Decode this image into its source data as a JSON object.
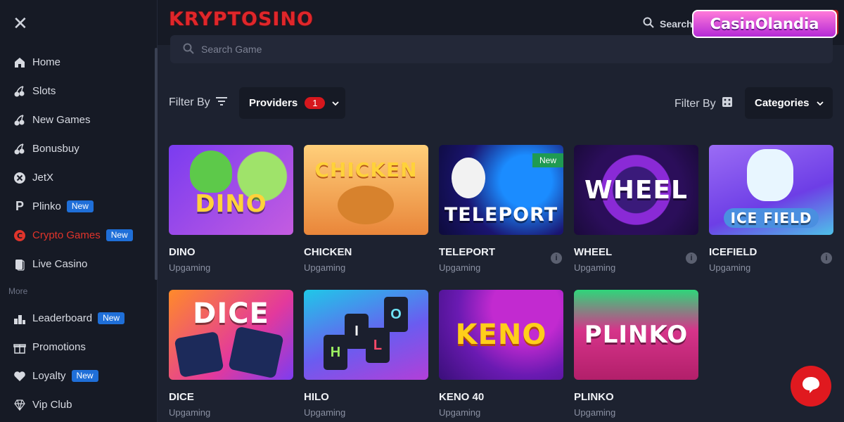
{
  "brand": {
    "logo_text": "KRYPTOSINO"
  },
  "watermark": {
    "text": "CasinOlandia"
  },
  "header": {
    "search_label": "Search"
  },
  "sidebar": {
    "items": [
      {
        "label": "Home",
        "icon": "home-icon"
      },
      {
        "label": "Slots",
        "icon": "cherry-icon"
      },
      {
        "label": "New Games",
        "icon": "cherry-icon"
      },
      {
        "label": "Bonusbuy",
        "icon": "cherry-icon"
      },
      {
        "label": "JetX",
        "icon": "x-circle-icon"
      },
      {
        "label": "Plinko",
        "icon": "p-icon",
        "badge": "New"
      },
      {
        "label": "Crypto Games",
        "icon": "crypto-icon",
        "badge": "New",
        "active": true
      },
      {
        "label": "Live Casino",
        "icon": "cards-icon"
      }
    ],
    "section_label": "More",
    "more_items": [
      {
        "label": "Leaderboard",
        "icon": "leaderboard-icon",
        "badge": "New"
      },
      {
        "label": "Promotions",
        "icon": "gift-icon"
      },
      {
        "label": "Loyalty",
        "icon": "heart-icon",
        "badge": "New"
      },
      {
        "label": "Vip Club",
        "icon": "diamond-icon"
      }
    ]
  },
  "search": {
    "placeholder": "Search Game"
  },
  "filters": {
    "left_label": "Filter By",
    "providers_label": "Providers",
    "providers_count": "1",
    "right_label": "Filter By",
    "categories_label": "Categories"
  },
  "games": [
    {
      "title": "DINO",
      "provider": "Upgaming",
      "thumb_text": "DINO"
    },
    {
      "title": "CHICKEN",
      "provider": "Upgaming",
      "thumb_text": "CHICKEN"
    },
    {
      "title": "TELEPORT",
      "provider": "Upgaming",
      "thumb_text": "TELEPORT",
      "tag": "New",
      "info": true
    },
    {
      "title": "WHEEL",
      "provider": "Upgaming",
      "thumb_text": "WHEEL",
      "info": true
    },
    {
      "title": "ICEFIELD",
      "provider": "Upgaming",
      "thumb_text": "ICE FIELD",
      "info": true
    },
    {
      "title": "DICE",
      "provider": "Upgaming",
      "thumb_text": "DICE"
    },
    {
      "title": "HILO",
      "provider": "Upgaming",
      "thumb_text": ""
    },
    {
      "title": "KENO 40",
      "provider": "Upgaming",
      "thumb_text": "KENO"
    },
    {
      "title": "PLINKO",
      "provider": "Upgaming",
      "thumb_text": "PLINKO"
    }
  ],
  "hilo_letters": [
    "H",
    "I",
    "L",
    "O"
  ],
  "colors": {
    "accent_red": "#e0342b",
    "badge_blue": "#1f6fd8",
    "bg": "#1d2230",
    "sidebar_bg": "#161a25"
  }
}
